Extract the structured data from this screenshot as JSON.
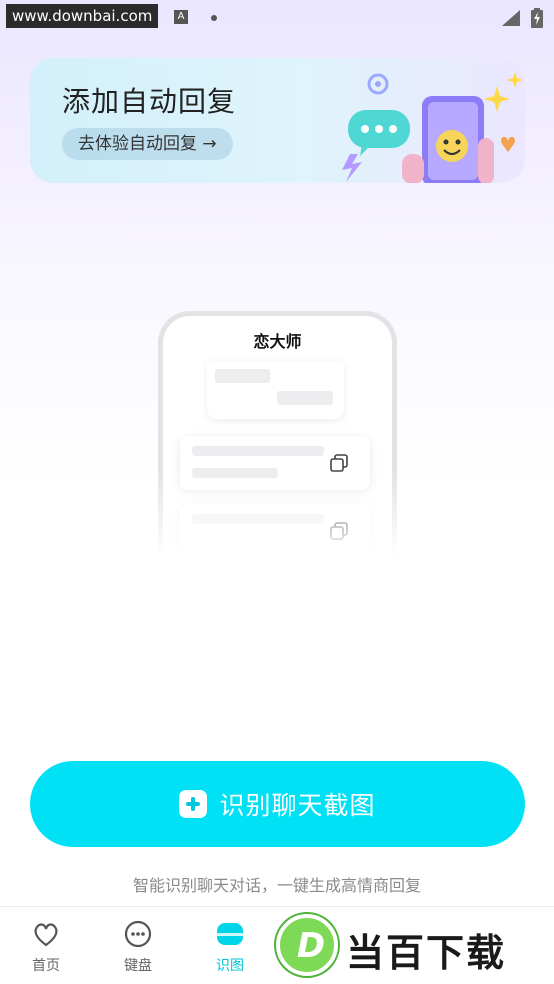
{
  "status_bar": {
    "site_watermark": "www.downbai.com",
    "notification_letter": "A"
  },
  "banner": {
    "title": "添加自动回复",
    "button_label": "去体验自动回复 →"
  },
  "illustration": {
    "phone_title": "恋大师"
  },
  "main": {
    "primary_button_label": "识别聊天截图",
    "hint": "智能识别聊天对话，一键生成高情商回复"
  },
  "bottom_nav": {
    "items": [
      {
        "label": "首页",
        "icon": "heart-icon",
        "active": false
      },
      {
        "label": "键盘",
        "icon": "keyboard-face-icon",
        "active": false
      },
      {
        "label": "识图",
        "icon": "scan-image-icon",
        "active": true
      }
    ]
  },
  "watermark": {
    "logo_letter": "D",
    "text": "当百下载"
  },
  "colors": {
    "accent": "#00e1f5",
    "nav_active": "#00c4d6"
  }
}
